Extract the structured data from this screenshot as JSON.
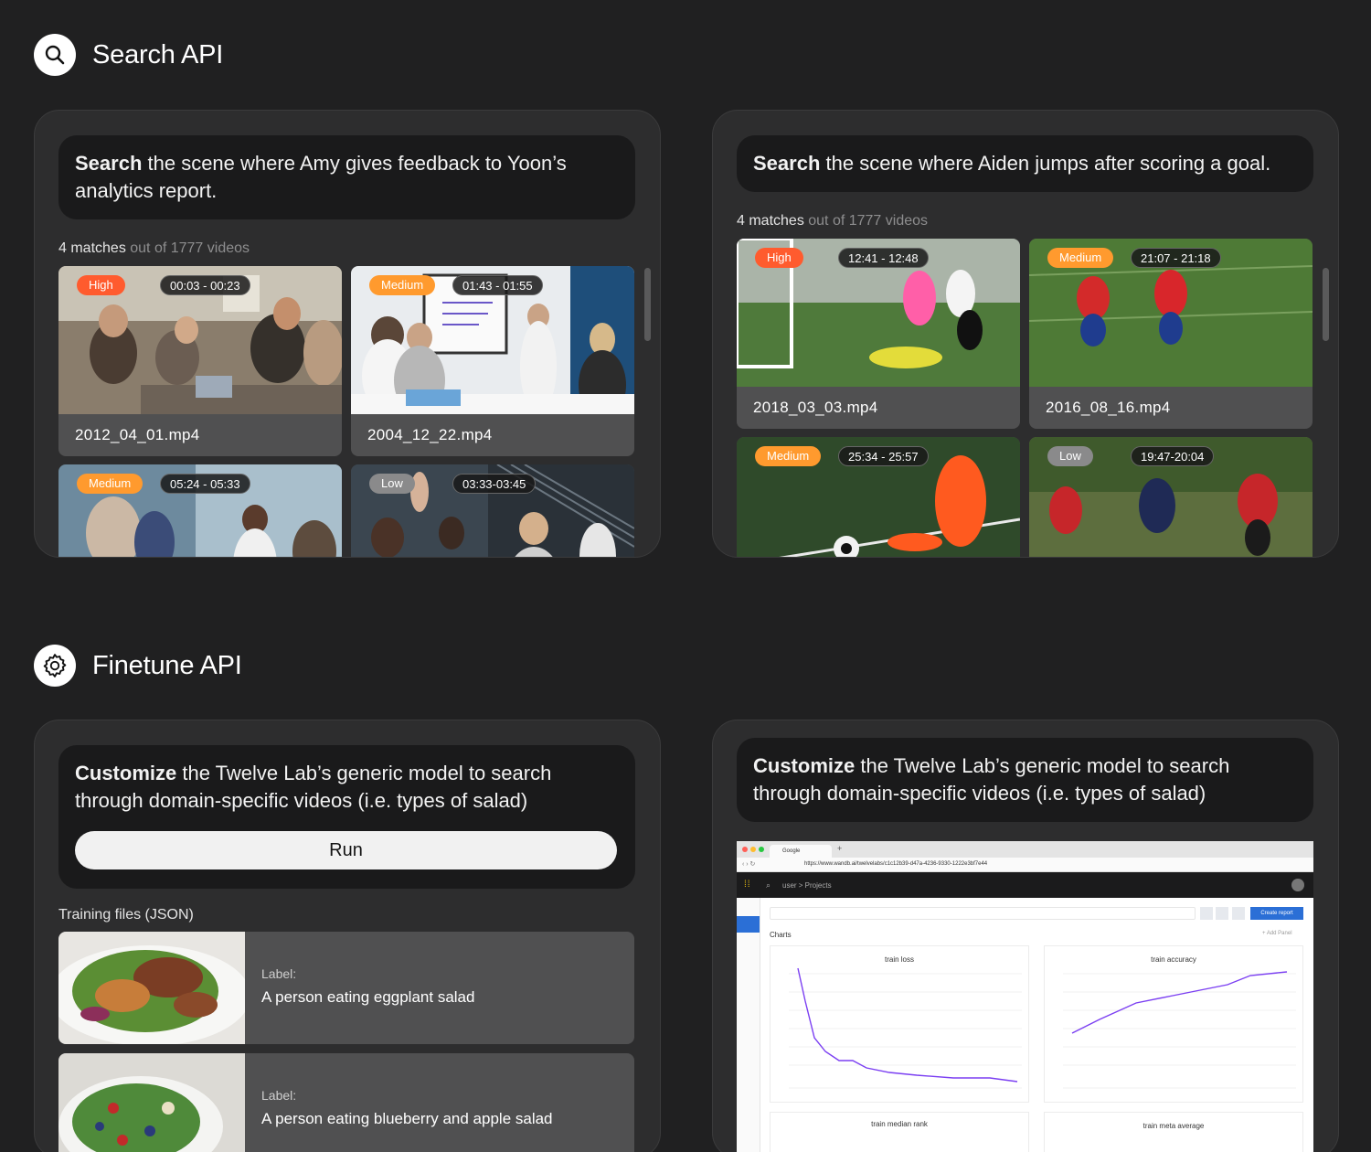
{
  "search_section": {
    "title": "Search API",
    "icon": "search-icon"
  },
  "finetune_section": {
    "title": "Finetune API",
    "icon": "gear-icon"
  },
  "search_panels": [
    {
      "query_bold": "Search",
      "query_rest": " the scene where Amy gives feedback to Yoon’s analytics report.",
      "matches_count": "4 matches",
      "matches_total": " out of 1777 videos",
      "results": [
        {
          "badge": "High",
          "time": "00:03 - 00:23",
          "file": "2012_04_01.mp4"
        },
        {
          "badge": "Medium",
          "time": "01:43 - 01:55",
          "file": "2004_12_22.mp4"
        },
        {
          "badge": "Medium",
          "time": "05:24 - 05:33",
          "file": ""
        },
        {
          "badge": "Low",
          "time": "03:33-03:45",
          "file": ""
        }
      ]
    },
    {
      "query_bold": "Search",
      "query_rest": " the scene where Aiden jumps after scoring a goal.",
      "matches_count": "4 matches",
      "matches_total": " out of 1777 videos",
      "results": [
        {
          "badge": "High",
          "time": "12:41 - 12:48",
          "file": "2018_03_03.mp4"
        },
        {
          "badge": "Medium",
          "time": "21:07 - 21:18",
          "file": "2016_08_16.mp4"
        },
        {
          "badge": "Medium",
          "time": "25:34 - 25:57",
          "file": ""
        },
        {
          "badge": "Low",
          "time": "19:47-20:04",
          "file": ""
        }
      ]
    }
  ],
  "finetune_left": {
    "query_bold": "Customize",
    "query_rest": " the Twelve Lab’s generic model to search through domain-specific videos (i.e. types of salad)",
    "run_label": "Run",
    "training_label": "Training files (JSON)",
    "rows": [
      {
        "label_key": "Label:",
        "label_value": "A person eating eggplant salad"
      },
      {
        "label_key": "Label:",
        "label_value": "A person eating blueberry and apple salad"
      }
    ]
  },
  "finetune_right": {
    "query_bold": "Customize",
    "query_rest": " the Twelve Lab’s generic model to search through domain-specific videos (i.e. types of salad)",
    "browser": {
      "tab_title": "Google",
      "url": "https://www.wandb.ai/twelvelabs/c1c12b39-d47a-4236-9330-1222e3bf7e44",
      "breadcrumb": "user > Projects",
      "create_report": "Create report",
      "add_panel": "+ Add Panel",
      "charts_heading": "Charts",
      "chart_titles": [
        "train loss",
        "train accuracy",
        "train median rank",
        "train meta average"
      ]
    }
  },
  "colors": {
    "high": "#ff5b2e",
    "medium": "#ff9a2e",
    "low": "#8a8a8b",
    "chart_line": "#7b3ff2"
  }
}
